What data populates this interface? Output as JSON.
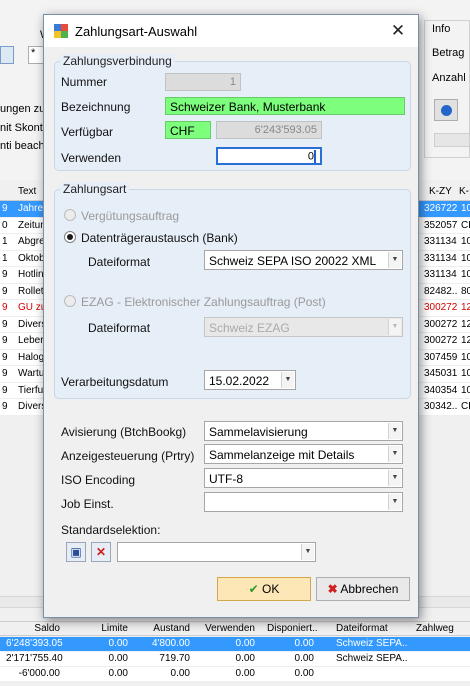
{
  "background": {
    "w_label": "W",
    "field_value": "*",
    "frag1": "ungen zu",
    "frag2": "nit Skonto",
    "frag3": "nti beach",
    "info_title": "Info",
    "info_betrag": "Betrag",
    "info_anzahl": "Anzahl",
    "grid_headers": [
      "Text",
      "K-ZY",
      "K-"
    ],
    "rows": [
      {
        "a": "9",
        "text": "Jahre",
        "code": "326722",
        "cur": "10",
        "sel": true
      },
      {
        "a": "0",
        "text": "Zeitun",
        "code": "352057",
        "cur": "CH"
      },
      {
        "a": "1",
        "text": "Abgre",
        "code": "331134",
        "cur": "10"
      },
      {
        "a": "1",
        "text": "Oktob",
        "code": "331134",
        "cur": "10"
      },
      {
        "a": "9",
        "text": "Hotlin",
        "code": "331134",
        "cur": "10"
      },
      {
        "a": "9",
        "text": "Rollet",
        "code": "82482..",
        "cur": "80"
      },
      {
        "a": "9",
        "text": "GU zu",
        "code": "300272",
        "cur": "12",
        "red": true
      },
      {
        "a": "9",
        "text": "Divers",
        "code": "300272",
        "cur": "12"
      },
      {
        "a": "9",
        "text": "Leber",
        "code": "300272",
        "cur": "12"
      },
      {
        "a": "9",
        "text": "Halog",
        "code": "307459",
        "cur": "10"
      },
      {
        "a": "9",
        "text": "Wartu",
        "code": "345031",
        "cur": "10"
      },
      {
        "a": "9",
        "text": "Tierfu",
        "code": "340354",
        "cur": "10"
      },
      {
        "a": "9",
        "text": "Divers",
        "code": "30342..",
        "cur": "CH"
      }
    ],
    "bottom_headers": [
      "Saldo",
      "Limite",
      "Austand",
      "Verwenden",
      "Disponiert..",
      "Dateiformat",
      "Zahlweg"
    ],
    "bottom_rows": [
      [
        "6'248'393.05",
        "0.00",
        "4'800.00",
        "0.00",
        "0.00",
        "Schweiz SEPA..",
        ""
      ],
      [
        "2'171'755.40",
        "0.00",
        "719.70",
        "0.00",
        "0.00",
        "Schweiz SEPA..",
        ""
      ],
      [
        "-6'000.00",
        "0.00",
        "0.00",
        "0.00",
        "0.00",
        "",
        ""
      ]
    ]
  },
  "dialog": {
    "title": "Zahlungsart-Auswahl",
    "close_symbol": "✕",
    "zahlungsverbindung": {
      "group_title": "Zahlungsverbindung",
      "nummer_label": "Nummer",
      "nummer_value": "1",
      "bezeichnung_label": "Bezeichnung",
      "bezeichnung_value": "Schweizer Bank, Musterbank",
      "verfuegbar_label": "Verfügbar",
      "currency": "CHF",
      "verfuegbar_value": "6'243'593.05",
      "verwenden_label": "Verwenden",
      "verwenden_value": "0"
    },
    "zahlungsart": {
      "group_title": "Zahlungsart",
      "radio1_label": "Vergütungsauftrag",
      "radio2_label": "Datenträgeraustausch (Bank)",
      "dateiformat_label": "Dateiformat",
      "dateiformat_value": "Schweiz SEPA ISO 20022 XML",
      "radio3_label": "EZAG - Elektronischer Zahlungsauftrag (Post)",
      "dateiformat2_label": "Dateiformat",
      "dateiformat2_value": "Schweiz EZAG",
      "verarbeitungsdatum_label": "Verarbeitungsdatum",
      "verarbeitungsdatum_value": "15.02.2022"
    },
    "avisierung_label": "Avisierung (BtchBookg)",
    "avisierung_value": "Sammelavisierung",
    "anzeigesteuerung_label": "Anzeigesteuerung (Prtry)",
    "anzeigesteuerung_value": "Sammelanzeige mit Details",
    "iso_label": "ISO Encoding",
    "iso_value": "UTF-8",
    "job_label": "Job Einst.",
    "job_value": "",
    "standard_label": "Standardselektion:",
    "standard_value": "",
    "ok_label": "OK",
    "cancel_label": "Abbrechen"
  },
  "colors": {
    "accent": "#3399ff",
    "green_field": "#7dff7d",
    "ok_bg": "#fde7b6"
  }
}
